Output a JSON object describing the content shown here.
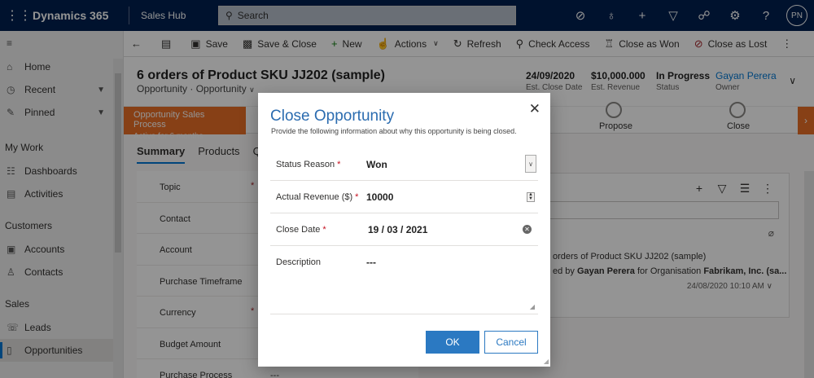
{
  "topbar": {
    "app_title": "Dynamics 365",
    "hub_name": "Sales Hub",
    "search_placeholder": "Search",
    "avatar_initials": "PN"
  },
  "leftnav": {
    "top_items": [
      {
        "label": "Home",
        "icon": "home-icon"
      },
      {
        "label": "Recent",
        "icon": "clock-icon"
      },
      {
        "label": "Pinned",
        "icon": "pin-icon"
      }
    ],
    "sections": [
      {
        "title": "My Work",
        "items": [
          {
            "label": "Dashboards"
          },
          {
            "label": "Activities"
          }
        ]
      },
      {
        "title": "Customers",
        "items": [
          {
            "label": "Accounts"
          },
          {
            "label": "Contacts"
          }
        ]
      },
      {
        "title": "Sales",
        "items": [
          {
            "label": "Leads"
          },
          {
            "label": "Opportunities"
          }
        ]
      }
    ]
  },
  "commandbar": {
    "save": "Save",
    "save_close": "Save & Close",
    "new": "New",
    "actions": "Actions",
    "refresh": "Refresh",
    "check_access": "Check Access",
    "close_won": "Close as Won",
    "close_lost": "Close as Lost"
  },
  "header": {
    "title": "6 orders of Product SKU JJ202 (sample)",
    "subtitle": "Opportunity · Opportunity",
    "fields": [
      {
        "value": "24/09/2020",
        "label": "Est. Close Date"
      },
      {
        "value": "$10,000.000",
        "label": "Est. Revenue"
      },
      {
        "value": "In Progress",
        "label": "Status"
      },
      {
        "value": "Gayan Perera",
        "label": "Owner"
      }
    ]
  },
  "bpf": {
    "stage_title": "Opportunity Sales Process",
    "stage_sub": "Active for 6 months",
    "stages": [
      "Propose",
      "Close"
    ]
  },
  "form": {
    "tabs": [
      "Summary",
      "Products",
      "Qu"
    ],
    "fields": [
      "Topic",
      "Contact",
      "Account",
      "Purchase Timeframe",
      "Currency",
      "Budget Amount",
      "Purchase Process"
    ],
    "purchase_process_value": "---"
  },
  "timeline": {
    "title": "orders of Product SKU JJ202 (sample)",
    "desc_prefix": "ed by",
    "desc_user": "Gayan Perera",
    "desc_mid": "for Organisation",
    "desc_org": "Fabrikam, Inc. (sa...",
    "date": "24/08/2020 10:10 AM"
  },
  "dialog": {
    "title": "Close Opportunity",
    "subtitle": "Provide the following information about why this opportunity is being closed.",
    "status_reason_label": "Status Reason",
    "status_reason_value": "Won",
    "actual_revenue_label": "Actual Revenue ($)",
    "actual_revenue_value": "10000",
    "close_date_label": "Close Date",
    "close_date_value": "19 / 03 / 2021",
    "description_label": "Description",
    "description_value": "---",
    "required_marker": "*",
    "ok_label": "OK",
    "cancel_label": "Cancel"
  }
}
